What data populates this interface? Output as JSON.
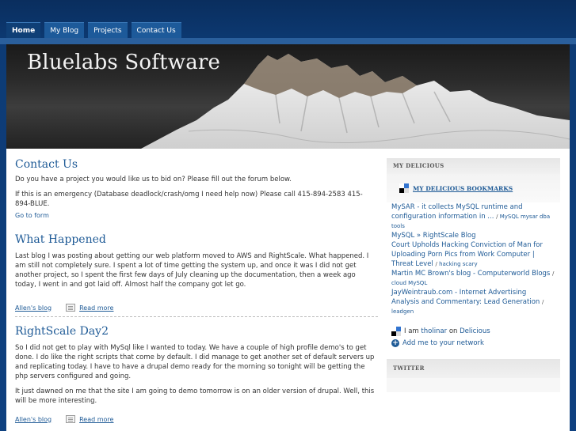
{
  "nav": {
    "items": [
      {
        "label": "Home",
        "active": true
      },
      {
        "label": "My Blog",
        "active": false
      },
      {
        "label": "Projects",
        "active": false
      },
      {
        "label": "Contact Us",
        "active": false
      }
    ]
  },
  "header": {
    "site_name": "Bluelabs Software"
  },
  "main": {
    "contact": {
      "title": "Contact Us",
      "p1": "Do you have a project you would like us to bid on? Please fill out the forum below.",
      "p2": "If this is an emergency (Database deadlock/crash/omg I need help now) Please call 415-894-2583 415-894-BLUE.",
      "form_link": "Go to form"
    },
    "posts": [
      {
        "title": "What Happened",
        "body": " Last blog I was posting about getting our web platform moved to AWS and RightScale. What happened. I am still not completely sure. I spent a lot of time getting the system up, and once it was I did not get another project, so I spent the first few days of July cleaning up the documentation, then a week ago today, I went in and got laid off. Almost half the company got let go.",
        "blog_link": "Allen's blog",
        "read_more": "Read more"
      },
      {
        "title": "RightScale Day2",
        "body": " So I did not get to play with MySql like I wanted to today. We have a couple of high profile demo's to get done. I do like the right scripts that come by default. I did manage to get another set of default servers up and replicating today. I have to have a drupal demo ready for the morning so tonight will be getting the php servers configured and going.",
        "body2": "It just dawned on me that the site I am going to demo tomorrow is on an older version of drupal. Well, this will be more interesting.",
        "blog_link": "Allen's blog",
        "read_more": "Read more"
      }
    ]
  },
  "sidebar": {
    "delicious": {
      "block_title": "MY DELICIOUS",
      "sub_title": "MY DELICIOUS BOOKMARKS",
      "bookmarks": [
        {
          "title": "MySAR - it collects MySQL runtime and configuration information in ...",
          "tags": "MySQL mysar dba tools"
        },
        {
          "title": "MySQL » RightScale Blog",
          "tags": ""
        },
        {
          "title": "Court Upholds Hacking Conviction of Man for Uploading Porn Pics from Work Computer | Threat Level",
          "tags": "hacking scary"
        },
        {
          "title": "Martin MC Brown's blog - Computerworld Blogs",
          "tags": "cloud MySQL"
        },
        {
          "title": "JayWeintraub.com - Internet Advertising Analysis and Commentary: Lead Generation",
          "tags": "leadgen"
        }
      ],
      "i_am_prefix": "I am ",
      "username": "tholinar",
      "on": " on ",
      "site": "Delicious",
      "add_network": "Add me to your network"
    },
    "twitter": {
      "block_title": "TWITTER"
    }
  },
  "colors": {
    "link": "#1e5a96",
    "nav_bg": "#1d5a9a",
    "page_bg": "#0d3b75"
  }
}
